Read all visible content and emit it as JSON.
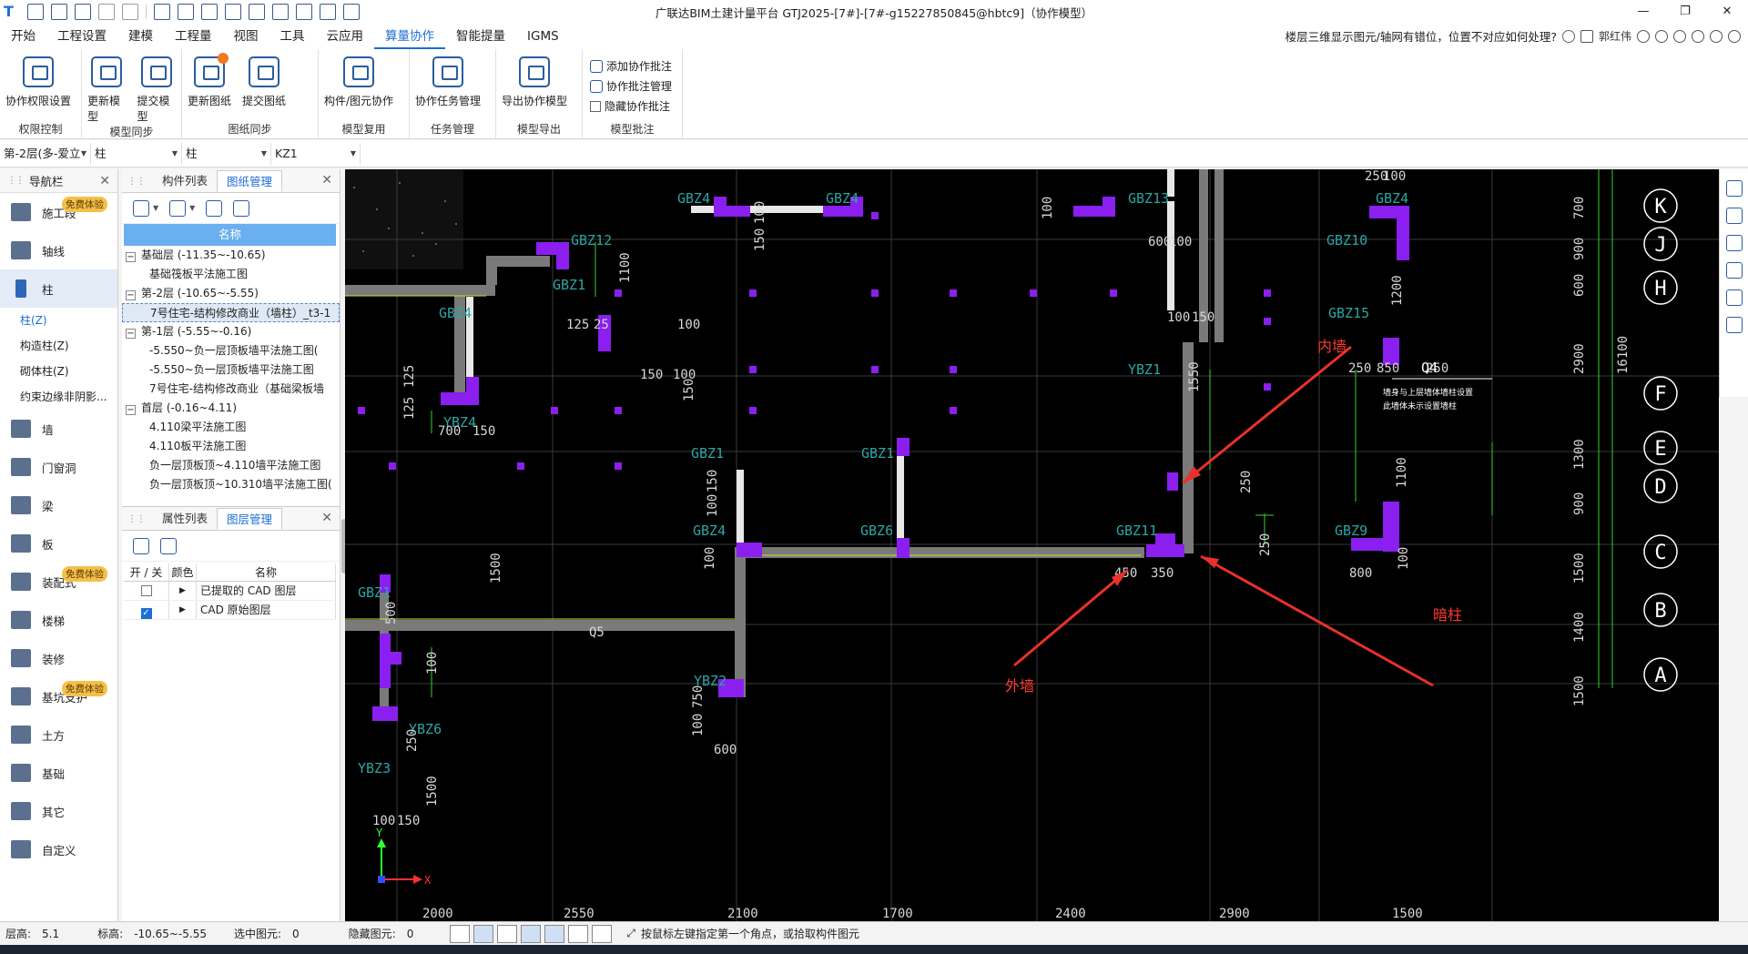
{
  "window": {
    "title": "广联达BIM土建计量平台 GTJ2025-[7#]-[7#-g15227850845@hbtc9]（协作模型）",
    "controls": [
      "—",
      "❐",
      "✕"
    ]
  },
  "menu": [
    "开始",
    "工程设置",
    "建模",
    "工程量",
    "视图",
    "工具",
    "云应用",
    "算量协作",
    "智能提量",
    "IGMS"
  ],
  "help": {
    "question": "楼层三维显示图元/轴网有错位，位置不对应如何处理?",
    "user": "郭红伟"
  },
  "ribbon": {
    "groups": [
      {
        "label": "权限控制",
        "buttons": [
          "协作权限设置"
        ]
      },
      {
        "label": "模型同步",
        "buttons": [
          "更新模型",
          "提交模型"
        ]
      },
      {
        "label": "图纸同步",
        "buttons": [
          "更新图纸",
          "提交图纸"
        ]
      },
      {
        "label": "模型复用",
        "buttons": [
          "构件/图元协作"
        ]
      },
      {
        "label": "任务管理",
        "buttons": [
          "协作任务管理"
        ]
      },
      {
        "label": "模型导出",
        "buttons": [
          "导出协作模型"
        ]
      },
      {
        "label": "模型批注",
        "small": [
          "添加协作批注",
          "协作批注管理",
          "隐藏协作批注"
        ]
      }
    ]
  },
  "selectors": [
    "第-2层(多-爱立",
    "柱",
    "柱",
    "KZ1"
  ],
  "nav": {
    "title": "导航栏",
    "items": [
      {
        "label": "施工段",
        "badge": "免费体验"
      },
      {
        "label": "轴线"
      },
      {
        "label": "柱",
        "active": true
      },
      {
        "label": "墙"
      },
      {
        "label": "门窗洞"
      },
      {
        "label": "梁"
      },
      {
        "label": "板"
      },
      {
        "label": "装配式",
        "badge": "免费体验"
      },
      {
        "label": "楼梯"
      },
      {
        "label": "装修"
      },
      {
        "label": "基坑支护",
        "badge": "免费体验"
      },
      {
        "label": "土方"
      },
      {
        "label": "基础"
      },
      {
        "label": "其它"
      },
      {
        "label": "自定义"
      }
    ],
    "subitems": [
      "柱(Z)",
      "构造柱(Z)",
      "砌体柱(Z)",
      "约束边缘非阴影..."
    ]
  },
  "drawing_panel": {
    "tabs": [
      "构件列表",
      "图纸管理"
    ],
    "header": "名称",
    "rows": [
      {
        "level": 1,
        "text": "基础层 (-11.35~-10.65)"
      },
      {
        "level": 2,
        "text": "基础筏板平法施工图"
      },
      {
        "level": 1,
        "text": "第-2层 (-10.65~-5.55)"
      },
      {
        "level": 2,
        "text": "7号住宅-结构修改商业（墙柱）_t3-1",
        "selected": true
      },
      {
        "level": 1,
        "text": "第-1层 (-5.55~-0.16)"
      },
      {
        "level": 2,
        "text": "-5.550~负一层顶板墙平法施工图("
      },
      {
        "level": 2,
        "text": "-5.550~负一层顶板墙平法施工图"
      },
      {
        "level": 2,
        "text": "7号住宅-结构修改商业（基础梁板墙"
      },
      {
        "level": 1,
        "text": "首层 (-0.16~4.11)"
      },
      {
        "level": 2,
        "text": "4.110梁平法施工图"
      },
      {
        "level": 2,
        "text": "4.110板平法施工图"
      },
      {
        "level": 2,
        "text": "负一层顶板顶~4.110墙平法施工图"
      },
      {
        "level": 2,
        "text": "负一层顶板顶~10.310墙平法施工图("
      }
    ]
  },
  "layer_panel": {
    "tabs": [
      "属性列表",
      "图层管理"
    ],
    "headers": [
      "开 / 关",
      "颜色",
      "名称"
    ],
    "rows": [
      {
        "on": false,
        "name": "已提取的 CAD 图层"
      },
      {
        "on": true,
        "name": "CAD 原始图层"
      }
    ]
  },
  "cad": {
    "axis_labels": [
      "K",
      "J",
      "H",
      "F",
      "E",
      "D",
      "C",
      "B",
      "A"
    ],
    "component_labels": [
      "GBZ4",
      "GBZ4",
      "GBZ13",
      "GBZ4",
      "GBZ12",
      "GBZ1",
      "GBZ10",
      "GBZ4",
      "YBZ1",
      "GBZ15",
      "YBZ4",
      "GBZ1",
      "GBZ1",
      "GBZ4",
      "GBZ6",
      "GBZ11",
      "GBZ9",
      "GBZ1",
      "YBZ2",
      "YBZ6",
      "YBZ3"
    ],
    "dims_right": [
      "700",
      "900",
      "600",
      "2900",
      "16100",
      "1300",
      "900",
      "1500",
      "1400",
      "1500"
    ],
    "dims_bottom": [
      "2000",
      "2550",
      "2100",
      "1700",
      "2400",
      "2900",
      "1500"
    ],
    "dims_misc": [
      "250",
      "100",
      "100",
      "150",
      "600",
      "100",
      "100",
      "1100",
      "1200",
      "125",
      "25",
      "100",
      "150",
      "1550",
      "250",
      "850",
      "250",
      "150",
      "100",
      "150",
      "700",
      "150",
      "125",
      "125",
      "150",
      "100",
      "250",
      "1100",
      "450",
      "350",
      "800",
      "100",
      "250",
      "100",
      "1500",
      "Q5",
      "750",
      "100",
      "600",
      "500",
      "100",
      "250",
      "1500",
      "100",
      "150",
      "100",
      "Q4"
    ],
    "annotations": {
      "inner_wall": "内墙",
      "outer_wall": "外墙",
      "hidden_column": "暗柱"
    },
    "note_lines": [
      "墙身与上层墙体墙柱设置",
      "此墙体未示设置墙柱"
    ],
    "axis_x": "X",
    "axis_y": "Y"
  },
  "status": {
    "floor_height_label": "层高:",
    "floor_height": "5.1",
    "elevation_label": "标高:",
    "elevation": "-10.65~-5.55",
    "selected_label": "选中图元:",
    "selected": "0",
    "hidden_label": "隐藏图元:",
    "hidden": "0",
    "hint": "按鼠标左键指定第一个角点，或拾取构件图元"
  }
}
